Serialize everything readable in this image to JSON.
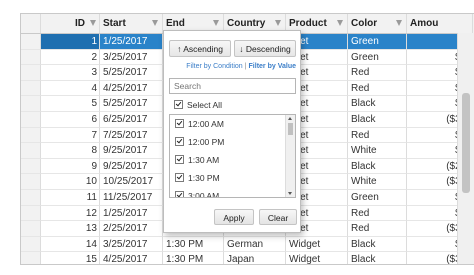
{
  "columns": [
    "ID",
    "Start",
    "End",
    "Country",
    "Product",
    "Color",
    "Amou"
  ],
  "rows": [
    {
      "id": "1",
      "start": "1/25/2017",
      "end": "",
      "country": "",
      "product": "dget",
      "color": "Green",
      "amount": "$5"
    },
    {
      "id": "2",
      "start": "3/25/2017",
      "end": "",
      "country": "",
      "product": "dget",
      "color": "Green",
      "amount": "$4,"
    },
    {
      "id": "3",
      "start": "5/25/2017",
      "end": "",
      "country": "",
      "product": "dget",
      "color": "Red",
      "amount": "$6,"
    },
    {
      "id": "4",
      "start": "4/25/2017",
      "end": "",
      "country": "",
      "product": "dget",
      "color": "Red",
      "amount": "$1,"
    },
    {
      "id": "5",
      "start": "5/25/2017",
      "end": "",
      "country": "",
      "product": "dget",
      "color": "Black",
      "amount": "$4,"
    },
    {
      "id": "6",
      "start": "6/25/2017",
      "end": "",
      "country": "",
      "product": "dget",
      "color": "Black",
      "amount": "($3,1"
    },
    {
      "id": "7",
      "start": "7/25/2017",
      "end": "",
      "country": "",
      "product": "dget",
      "color": "Red",
      "amount": "$4,"
    },
    {
      "id": "8",
      "start": "9/25/2017",
      "end": "",
      "country": "",
      "product": "dget",
      "color": "White",
      "amount": "$3,"
    },
    {
      "id": "9",
      "start": "9/25/2017",
      "end": "",
      "country": "",
      "product": "dget",
      "color": "Black",
      "amount": "($2,3"
    },
    {
      "id": "10",
      "start": "10/25/2017",
      "end": "",
      "country": "",
      "product": "dget",
      "color": "White",
      "amount": "($3,2"
    },
    {
      "id": "11",
      "start": "11/25/2017",
      "end": "",
      "country": "",
      "product": "dget",
      "color": "Green",
      "amount": "$5,"
    },
    {
      "id": "12",
      "start": "1/25/2017",
      "end": "",
      "country": "",
      "product": "dget",
      "color": "Red",
      "amount": "$3,"
    },
    {
      "id": "13",
      "start": "2/25/2017",
      "end": "",
      "country": "",
      "product": "dget",
      "color": "Red",
      "amount": "($3,9"
    },
    {
      "id": "14",
      "start": "3/25/2017",
      "end": "1:30 PM",
      "country": "German",
      "product": "Widget",
      "color": "Black",
      "amount": "$3,"
    },
    {
      "id": "15",
      "start": "4/25/2017",
      "end": "1:30 PM",
      "country": "Japan",
      "product": "Widget",
      "color": "Black",
      "amount": "($3,7"
    }
  ],
  "selected_row_index": 0,
  "filter_popup": {
    "sort_ascending": "↑ Ascending",
    "sort_descending": "↓ Descending",
    "filter_by_condition": "Filter by Condition",
    "separator": "|",
    "filter_by_value": "Filter by Value",
    "search_placeholder": "Search",
    "select_all": "Select All",
    "values": [
      "12:00 AM",
      "12:00 PM",
      "1:30 AM",
      "1:30 PM",
      "3:00 AM"
    ],
    "apply": "Apply",
    "clear": "Clear"
  },
  "colors": {
    "selection": "#2a83c9",
    "header_bg": "#f2f2f2",
    "link": "#3b7ec8"
  }
}
